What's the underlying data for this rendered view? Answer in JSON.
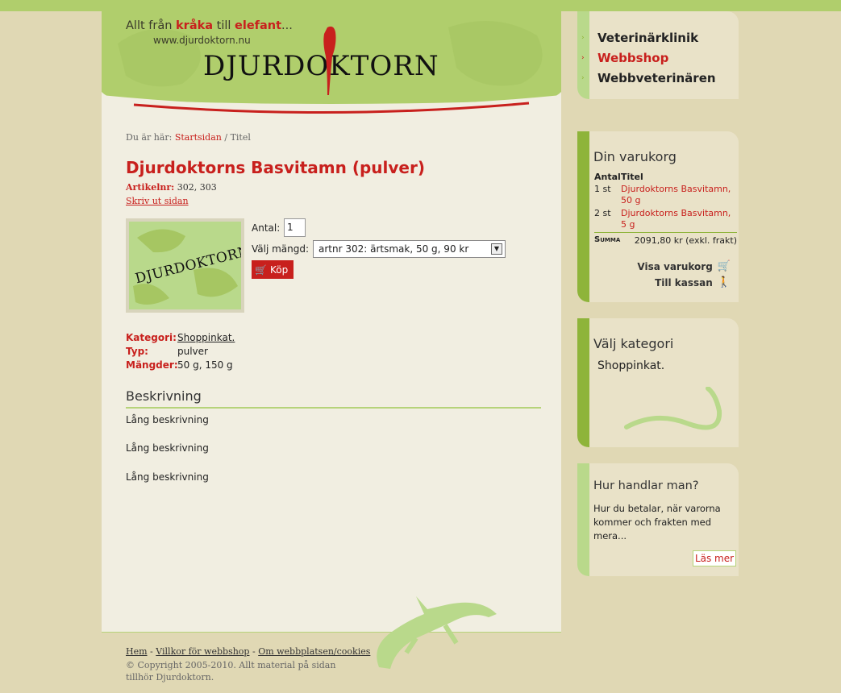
{
  "header": {
    "tagline_parts": [
      "Allt från ",
      "kråka",
      " till ",
      "elefant",
      "..."
    ],
    "url": "www.djurdoktorn.nu",
    "logo": "DJURDOKTORN"
  },
  "nav": {
    "items": [
      {
        "label": "Veterinärklinik"
      },
      {
        "label": "Webbshop"
      },
      {
        "label": "Webbveterinären"
      }
    ]
  },
  "breadcrumb": {
    "prefix": "Du är här: ",
    "home": "Startsidan",
    "separator": " / ",
    "current": "Titel"
  },
  "product": {
    "title": "Djurdoktorns Basvitamn (pulver)",
    "artnr_label": "Artikelnr:",
    "artnr": "302, 303",
    "print_link": "Skriv ut sidan",
    "image_logo": "DJURDOKTORN",
    "antal_label": "Antal:",
    "antal_value": "1",
    "mangd_label": "Välj mängd:",
    "mangd_selected": "artnr 302: ärtsmak, 50 g, 90 kr",
    "buy_label": "Köp",
    "attributes": [
      {
        "key": "Kategori:",
        "value": "Shoppinkat."
      },
      {
        "key": "Typ:",
        "value": "pulver"
      },
      {
        "key": "Mängder:",
        "value": "50 g, 150 g"
      }
    ],
    "description_heading": "Beskrivning",
    "description": [
      "Lång beskrivning",
      "Lång beskrivning",
      "Lång beskrivning"
    ]
  },
  "cart": {
    "title": "Din varukorg",
    "col_antal": "Antal",
    "col_titel": "Titel",
    "rows": [
      {
        "qty": "1 st",
        "title": "Djurdoktorns Basvitamn, 50 g"
      },
      {
        "qty": "2 st",
        "title": "Djurdoktorns Basvitamn, 5 g"
      }
    ],
    "sum_label": "Summa",
    "sum_value": "2091,80 kr (exkl. frakt)",
    "view_cart": "Visa varukorg",
    "checkout": "Till kassan"
  },
  "categories": {
    "title": "Välj kategori",
    "items": [
      "Shoppinkat."
    ]
  },
  "help": {
    "title": "Hur handlar man?",
    "text": "Hur du betalar, när varorna kommer och frakten med mera...",
    "more": "Läs mer"
  },
  "footer": {
    "links": [
      "Hem",
      "Villkor för webbshop",
      "Om webbplatsen/cookies"
    ],
    "separator": " - ",
    "copyright": "© Copyright 2005-2010. Allt material på sidan tillhör Djurdoktorn."
  },
  "colors": {
    "accent": "#c8201d",
    "green": "#8eb43a",
    "light_green": "#b9d98b",
    "bg": "#e0d8b4"
  }
}
